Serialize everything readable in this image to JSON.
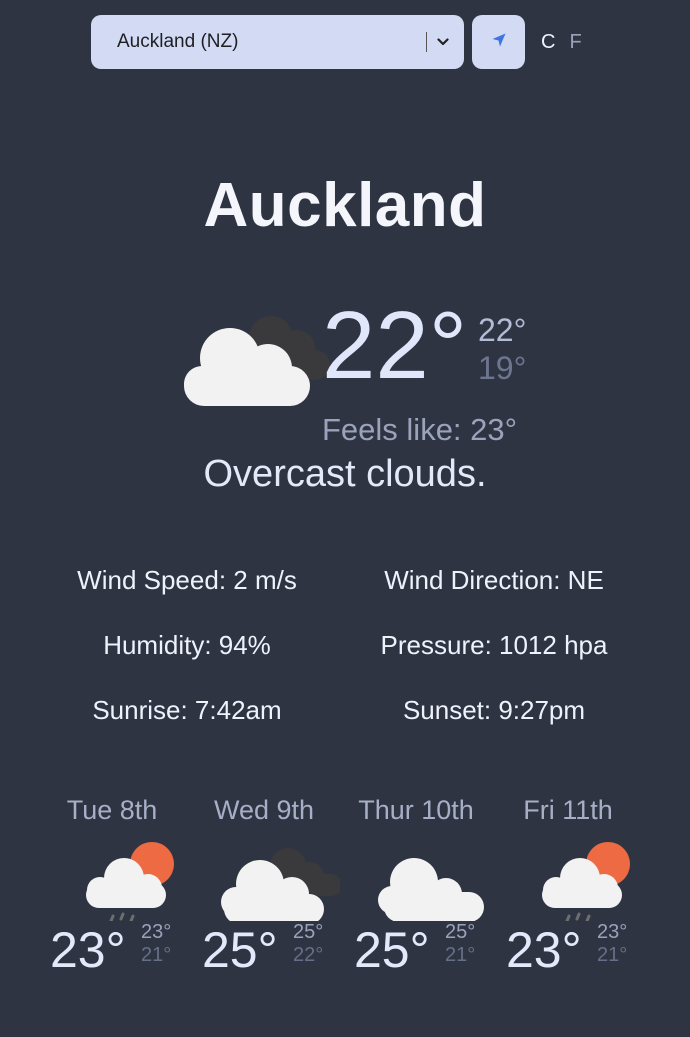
{
  "controls": {
    "city_value": "Auckland (NZ)",
    "unit_c": "C",
    "unit_f": "F",
    "location_icon": "location-arrow-icon",
    "chevron_icon": "chevron-down-icon"
  },
  "current": {
    "city": "Auckland",
    "temp": "22°",
    "high": "22°",
    "low": "19°",
    "feels_like": "Feels like: 23°",
    "description": "Overcast clouds.",
    "icon": "overcast-clouds-icon"
  },
  "stats": {
    "wind_speed": "Wind Speed: 2 m/s",
    "wind_direction": "Wind Direction: NE",
    "humidity": "Humidity: 94%",
    "pressure": "Pressure: 1012 hpa",
    "sunrise": "Sunrise: 7:42am",
    "sunset": "Sunset: 9:27pm"
  },
  "forecast": [
    {
      "day": "Tue 8th",
      "temp": "23°",
      "high": "23°",
      "low": "21°",
      "icon": "sun-rain-cloud-icon"
    },
    {
      "day": "Wed 9th",
      "temp": "25°",
      "high": "25°",
      "low": "22°",
      "icon": "overcast-clouds-icon"
    },
    {
      "day": "Thur 10th",
      "temp": "25°",
      "high": "25°",
      "low": "21°",
      "icon": "cloud-icon"
    },
    {
      "day": "Fri 11th",
      "temp": "23°",
      "high": "23°",
      "low": "21°",
      "icon": "sun-rain-cloud-icon"
    }
  ],
  "colors": {
    "background": "#2f3443",
    "control_bg": "#d2dbf3",
    "sun": "#ee6a43"
  }
}
